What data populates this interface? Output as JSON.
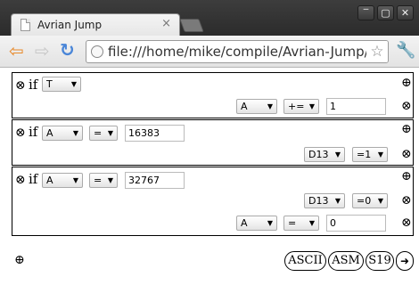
{
  "browser": {
    "tab_title": "Avrian Jump",
    "tab_close": "×",
    "url": "file:///home/mike/compile/Avrian-Jump/avrian",
    "window_buttons": [
      "‾",
      "▢",
      "✕"
    ]
  },
  "icons": {
    "remove": "⊗",
    "add": "⊕",
    "back": "⇦",
    "forward": "⇨",
    "reload": "↻",
    "star": "☆",
    "wrench": "🔧",
    "run": "➜"
  },
  "if_word": "if",
  "blocks": [
    {
      "condition": {
        "reg": "T"
      },
      "actions": [
        {
          "target": "A",
          "op": "+=",
          "value": "1"
        }
      ]
    },
    {
      "condition": {
        "reg": "A",
        "cmp": "=",
        "value": "16383"
      },
      "actions": [
        {
          "target": "D13",
          "op": "=1"
        }
      ]
    },
    {
      "condition": {
        "reg": "A",
        "cmp": "=",
        "value": "32767"
      },
      "actions": [
        {
          "target": "D13",
          "op": "=0"
        },
        {
          "target": "A",
          "op": "=",
          "value": "0"
        }
      ]
    }
  ],
  "footer_buttons": {
    "ascii": "ASCII",
    "asm": "ASM",
    "s19": "S19"
  }
}
